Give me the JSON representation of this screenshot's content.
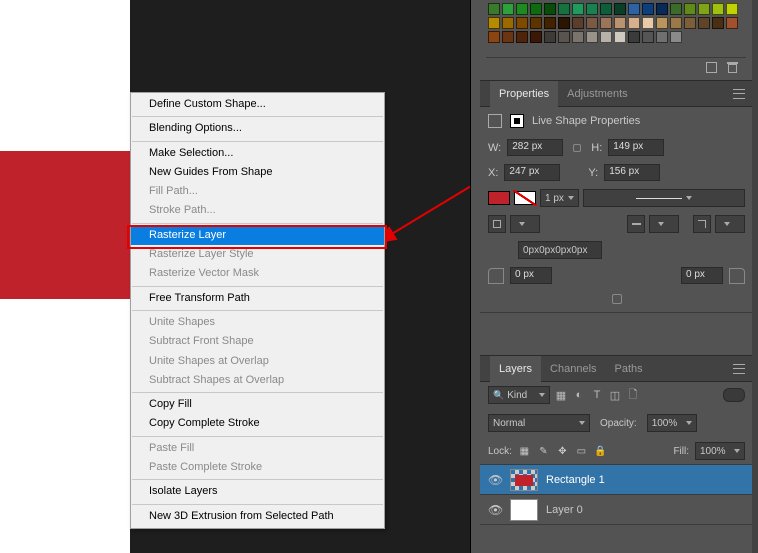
{
  "context_menu": {
    "items": [
      {
        "label": "Define Custom Shape...",
        "enabled": true
      },
      {
        "sep": true
      },
      {
        "label": "Blending Options...",
        "enabled": true
      },
      {
        "sep": true
      },
      {
        "label": "Make Selection...",
        "enabled": true
      },
      {
        "label": "New Guides From Shape",
        "enabled": true
      },
      {
        "label": "Fill Path...",
        "enabled": false
      },
      {
        "label": "Stroke Path...",
        "enabled": false
      },
      {
        "sep": true
      },
      {
        "label": "Rasterize Layer",
        "enabled": true,
        "highlight": true
      },
      {
        "label": "Rasterize Layer Style",
        "enabled": false
      },
      {
        "label": "Rasterize Vector Mask",
        "enabled": false
      },
      {
        "sep": true
      },
      {
        "label": "Free Transform Path",
        "enabled": true
      },
      {
        "sep": true
      },
      {
        "label": "Unite Shapes",
        "enabled": false
      },
      {
        "label": "Subtract Front Shape",
        "enabled": false
      },
      {
        "label": "Unite Shapes at Overlap",
        "enabled": false
      },
      {
        "label": "Subtract Shapes at Overlap",
        "enabled": false
      },
      {
        "sep": true
      },
      {
        "label": "Copy Fill",
        "enabled": true
      },
      {
        "label": "Copy Complete Stroke",
        "enabled": true
      },
      {
        "sep": true
      },
      {
        "label": "Paste Fill",
        "enabled": false
      },
      {
        "label": "Paste Complete Stroke",
        "enabled": false
      },
      {
        "sep": true
      },
      {
        "label": "Isolate Layers",
        "enabled": true
      },
      {
        "sep": true
      },
      {
        "label": "New 3D Extrusion from Selected Path",
        "enabled": true
      }
    ]
  },
  "swatches": {
    "colors": [
      "#3a7a2a",
      "#2fa03c",
      "#1f8a1f",
      "#0f6b0f",
      "#0a4d0a",
      "#16733f",
      "#209b5d",
      "#1b7f4f",
      "#0f5d39",
      "#0a3e26",
      "#2f62a0",
      "#0d3f7d",
      "#0a2a55",
      "#3a6b2a",
      "#5e8b1a",
      "#7fa41a",
      "#a0c010",
      "#c2d100",
      "#b78b00",
      "#9a6a00",
      "#7d4a00",
      "#5d3400",
      "#402200",
      "#2a1500",
      "#5a3d2a",
      "#7a5a44",
      "#9a755a",
      "#b99272",
      "#d5af8e",
      "#e8c9a8",
      "#b8945e",
      "#9a784a",
      "#7c5e3a",
      "#5e452a",
      "#4a2f14",
      "#a0522d",
      "#8b4513",
      "#6b3412",
      "#4e240b",
      "#3a1807",
      "#3e3a36",
      "#5a544e",
      "#7a746c",
      "#9a9389",
      "#b8b1a7",
      "#d0c9bf",
      "#3b3b3b",
      "#555",
      "#707070",
      "#8a8a8a"
    ]
  },
  "properties": {
    "tab_properties": "Properties",
    "tab_adjustments": "Adjustments",
    "header": "Live Shape Properties",
    "w_label": "W:",
    "w_value": "282 px",
    "h_label": "H:",
    "h_value": "149 px",
    "x_label": "X:",
    "x_value": "247 px",
    "y_label": "Y:",
    "y_value": "156 px",
    "stroke_width": "1 px",
    "corner_value": "0px0px0px0px",
    "radius_value": "0 px"
  },
  "layers": {
    "tab_layers": "Layers",
    "tab_channels": "Channels",
    "tab_paths": "Paths",
    "kind_label": "Kind",
    "blend_mode": "Normal",
    "opacity_label": "Opacity:",
    "opacity_value": "100%",
    "lock_label": "Lock:",
    "fill_label": "Fill:",
    "fill_value": "100%",
    "items": [
      {
        "name": "Rectangle 1",
        "selected": true,
        "shape": true
      },
      {
        "name": "Layer 0",
        "selected": false,
        "shape": false
      }
    ]
  }
}
